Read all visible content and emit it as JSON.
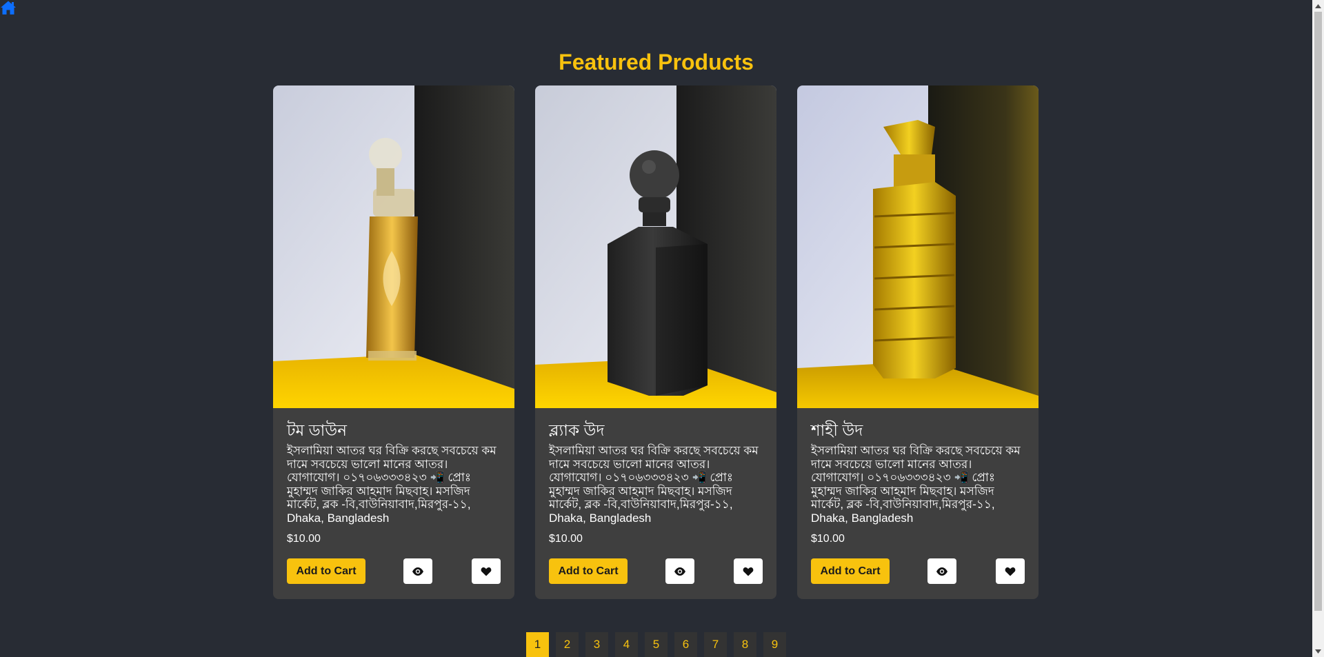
{
  "colors": {
    "background": "#282c34",
    "accent": "#f8c20e",
    "card_background": "#3f3f3f",
    "home_icon": "#0d6efd"
  },
  "nav": {
    "home_icon": "home-icon"
  },
  "page": {
    "title": "Featured Products"
  },
  "products": [
    {
      "name": "টম ডাউন",
      "description": "ইসলামিয়া আতর ঘর বিক্রি করছে সবচেয়ে কম দামে সবচেয়ে ভালো মানের আতর। যোগাযোগ। ০১৭০৬৩৩৩৪২৩ 📲 প্রোঃ মুহাম্মদ জাকির আহমাদ মিছবাহ। মসজিদ মার্কেট, ব্লক -বি,বাউনিয়াবাদ,মিরপুর-১১, Dhaka, Bangladesh",
      "price": "$10.00",
      "add_to_cart_label": "Add to Cart",
      "view_icon": "eye-icon",
      "favorite_icon": "heart-icon",
      "image": "clear glass perfume bottle with golden ornament"
    },
    {
      "name": "ব্ল্যাক উদ",
      "description": "ইসলামিয়া আতর ঘর বিক্রি করছে সবচেয়ে কম দামে সবচেয়ে ভালো মানের আতর। যোগাযোগ। ০১৭০৬৩৩৩৪২৩ 📲 প্রোঃ মুহাম্মদ জাকির আহমাদ মিছবাহ। মসজিদ মার্কেট, ব্লক -বি,বাউনিয়াবাদ,মিরপুর-১১, Dhaka, Bangladesh",
      "price": "$10.00",
      "add_to_cart_label": "Add to Cart",
      "view_icon": "eye-icon",
      "favorite_icon": "heart-icon",
      "image": "black matte perfume bottle with ball stopper"
    },
    {
      "name": "শাহী উদ",
      "description": "ইসলামিয়া আতর ঘর বিক্রি করছে সবচেয়ে কম দামে সবচেয়ে ভালো মানের আতর। যোগাযোগ। ০১৭০৬৩৩৩৪২৩ 📲 প্রোঃ মুহাম্মদ জাকির আহমাদ মিছবাহ। মসজিদ মার্কেট, ব্লক -বি,বাউনিয়াবাদ,মিরপুর-১১, Dhaka, Bangladesh",
      "price": "$10.00",
      "add_to_cart_label": "Add to Cart",
      "view_icon": "eye-icon",
      "favorite_icon": "heart-icon",
      "image": "golden faceted glass perfume bottle"
    }
  ],
  "pagination": {
    "pages": [
      "1",
      "2",
      "3",
      "4",
      "5",
      "6",
      "7",
      "8",
      "9"
    ],
    "current": "1"
  }
}
